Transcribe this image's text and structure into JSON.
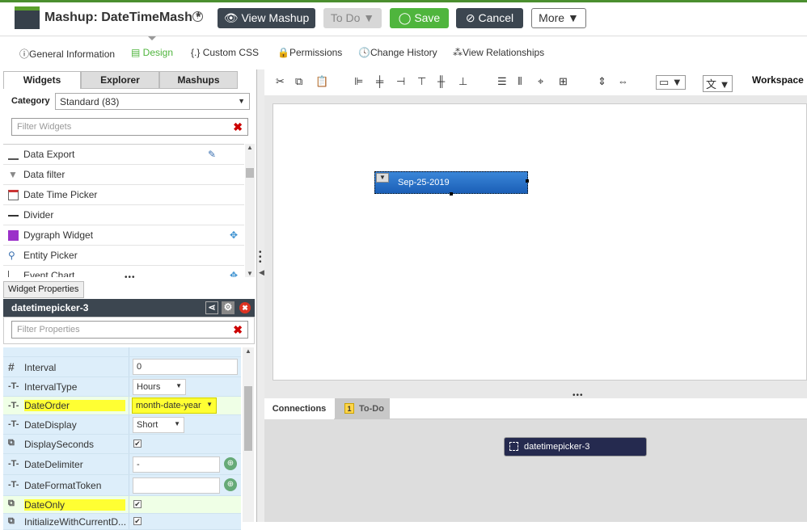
{
  "header": {
    "title": "Mashup: DateTimeMash *",
    "help_icon": "?",
    "view_label": "View Mashup",
    "todo_label": "To Do",
    "save_label": "Save",
    "cancel_label": "Cancel",
    "more_label": "More"
  },
  "tabs": [
    "General Information",
    "Design",
    "Custom CSS",
    "Permissions",
    "Change History",
    "View Relationships"
  ],
  "left": {
    "tabs": [
      "Widgets",
      "Explorer",
      "Mashups"
    ],
    "category_label": "Category",
    "category_value": "Standard (83)",
    "filter_widgets_placeholder": "Filter Widgets",
    "widgets": [
      "Data Export",
      "Data filter",
      "Date Time Picker",
      "Divider",
      "Dygraph Widget",
      "Entity Picker",
      "Event Chart"
    ],
    "props_tab": "Widget Properties",
    "props_widget_name": "datetimepicker-3",
    "filter_props_placeholder": "Filter Properties",
    "properties": [
      {
        "name": "Interval",
        "type_icon": "#",
        "value": "0"
      },
      {
        "name": "IntervalType",
        "type_icon": "T",
        "value": "Hours"
      },
      {
        "name": "DateOrder",
        "type_icon": "T",
        "value": "month-date-year"
      },
      {
        "name": "DateDisplay",
        "type_icon": "T",
        "value": "Short"
      },
      {
        "name": "DisplaySeconds",
        "type_icon": "chk",
        "value": "✔"
      },
      {
        "name": "DateDelimiter",
        "type_icon": "T",
        "value": "-"
      },
      {
        "name": "DateFormatToken",
        "type_icon": "T",
        "value": ""
      },
      {
        "name": "DateOnly",
        "type_icon": "chk",
        "value": "✔"
      },
      {
        "name": "InitializeWithCurrentD...",
        "type_icon": "chk",
        "value": "✔"
      }
    ]
  },
  "toolbar": {
    "workspace_label": "Workspace"
  },
  "canvas": {
    "widget_value": "Sep-25-2019"
  },
  "bottom": {
    "tabs": [
      "Connections",
      "To-Do"
    ],
    "todo_badge": "1",
    "widget_label": "datetimepicker-3"
  },
  "colors": {
    "accent_green": "#4fb53d",
    "dark": "#3c4650",
    "highlight": "#ffff33",
    "widget_blue": "#1b5fb7"
  }
}
